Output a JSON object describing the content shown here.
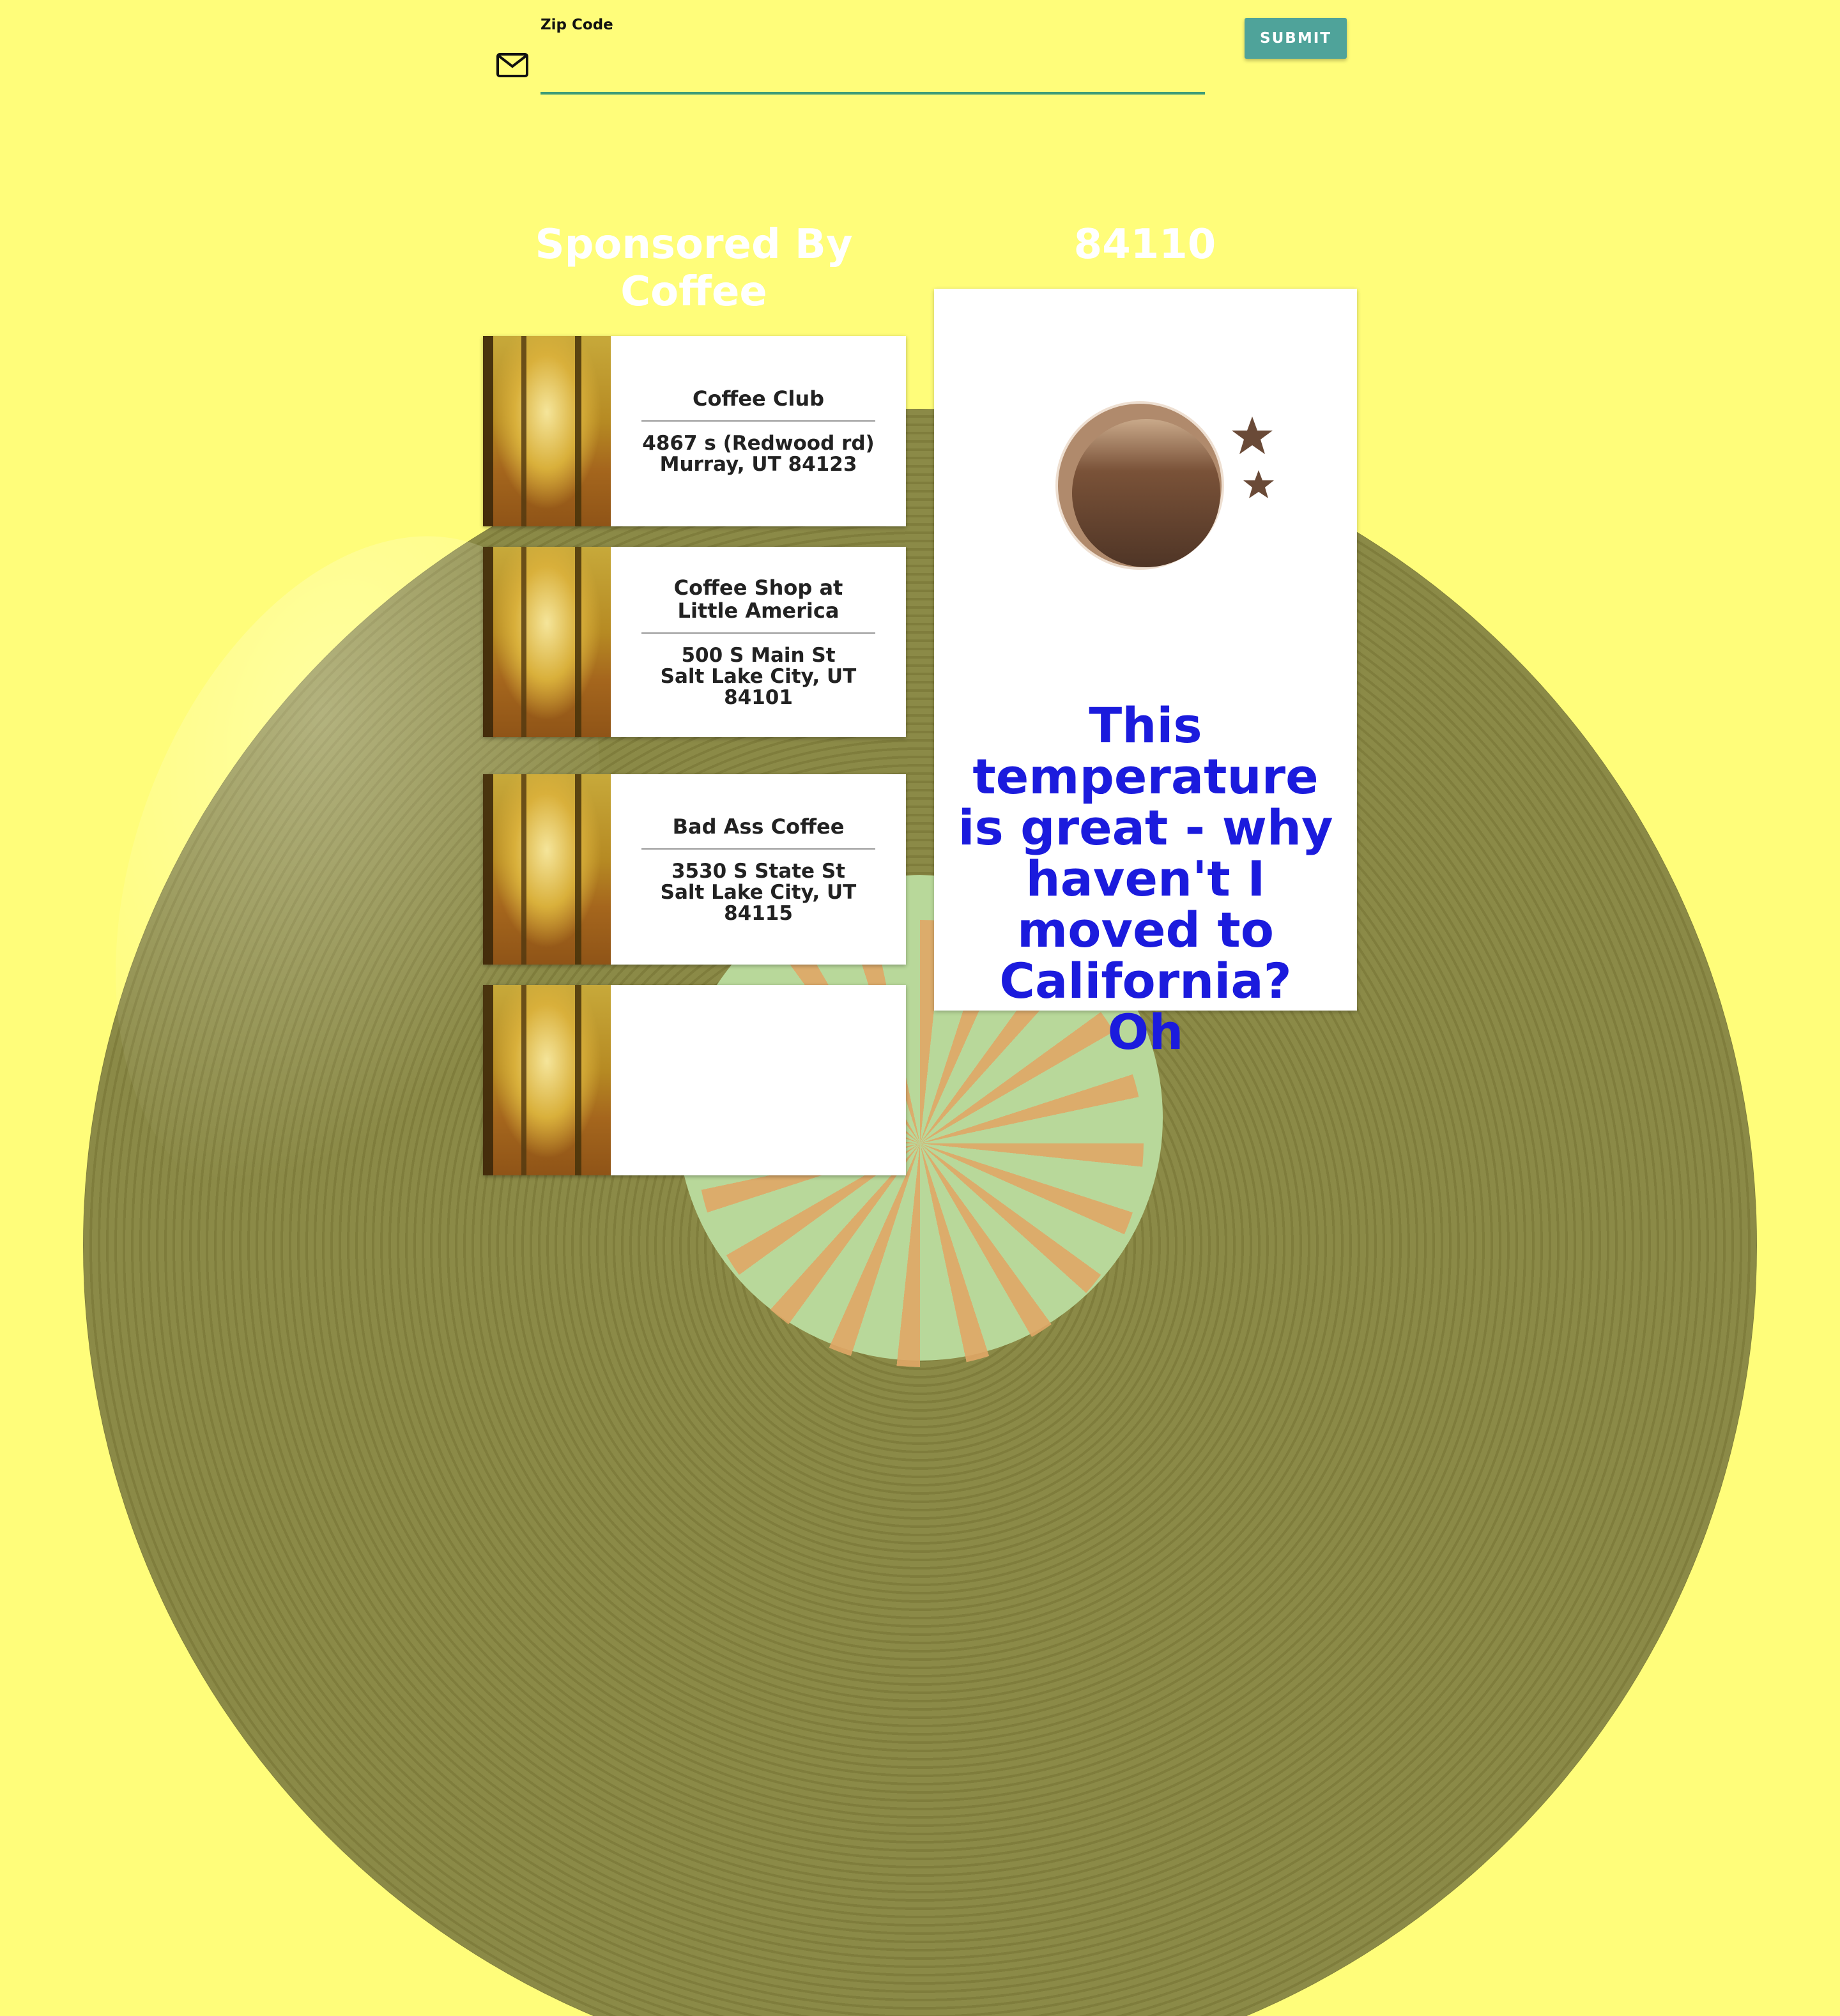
{
  "form": {
    "zip_label": "Zip Code",
    "zip_value": "",
    "submit_label": "SUBMIT",
    "icon": "mail-icon"
  },
  "sponsor": {
    "title": "Sponsored By Coffee",
    "shops": [
      {
        "name": "Coffee Club",
        "address_line1": "4867 s (Redwood rd)",
        "address_line2": "Murray, UT 84123"
      },
      {
        "name": "Coffee Shop at Little America",
        "address_line1": "500 S Main St",
        "address_line2": "Salt Lake City, UT 84101"
      },
      {
        "name": "Bad Ass Coffee",
        "address_line1": "3530 S State St",
        "address_line2": "Salt Lake City, UT 84115"
      },
      {
        "name": "",
        "address_line1": "",
        "address_line2": ""
      }
    ]
  },
  "weather": {
    "zip": "84110",
    "icon": "moon-stars-icon",
    "message": "This temperature is great - why haven't I moved to California? Oh"
  },
  "colors": {
    "background": "#fffd7a",
    "accent": "#4fa39a",
    "message_text": "#1b1bdd",
    "record": "#7f7d3c"
  }
}
